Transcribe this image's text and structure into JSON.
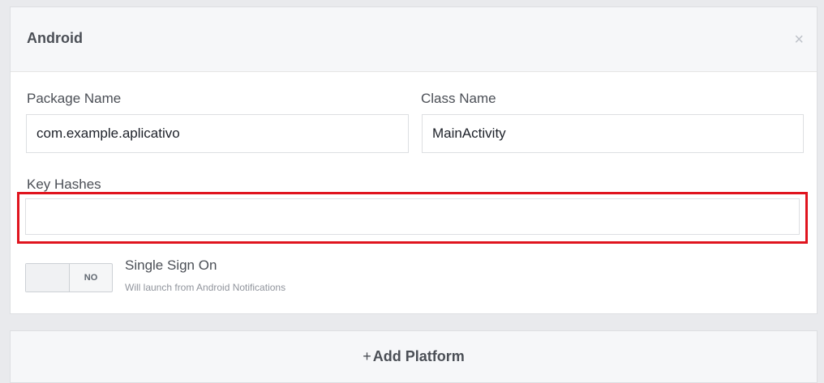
{
  "panel": {
    "title": "Android",
    "close_icon": "close-icon"
  },
  "form": {
    "package_name_label": "Package Name",
    "package_name_value": "com.example.aplicativo",
    "class_name_label": "Class Name",
    "class_name_value": "MainActivity",
    "key_hashes_label": "Key Hashes",
    "key_hashes_value": ""
  },
  "single_sign_on": {
    "toggle_state": "NO",
    "title": "Single Sign On",
    "subtitle": "Will launch from Android Notifications"
  },
  "add_platform": {
    "plus": "+",
    "label": "Add Platform"
  },
  "colors": {
    "highlight": "#e0141e"
  }
}
